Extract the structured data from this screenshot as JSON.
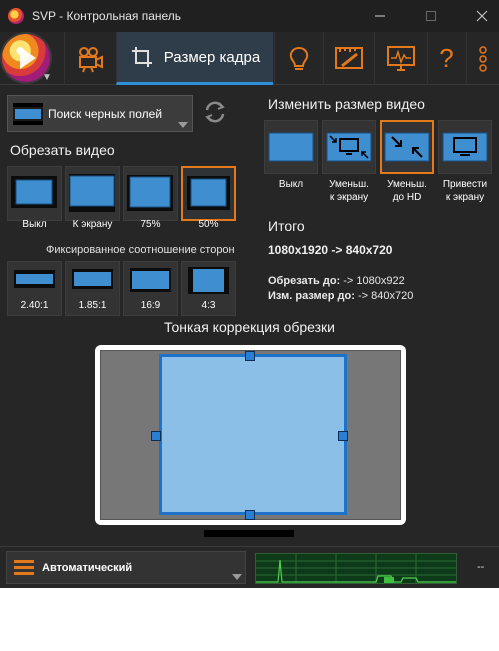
{
  "window": {
    "title": "SVP - Контрольная панель"
  },
  "titlebar": {
    "minimize_icon": "minimize-icon",
    "maximize_icon": "maximize-icon",
    "close_icon": "close-icon"
  },
  "toolbar": {
    "active_tab_label": "Размер кадра",
    "tabs": [
      "video-camera-icon",
      "crop-icon",
      "lightbulb-icon",
      "ruler-pencil-icon",
      "monitor-graph-icon",
      "help-icon",
      "more-vertical-icon"
    ],
    "help_label": "?"
  },
  "crop": {
    "detect_dropdown": "Поиск черных полей",
    "title": "Обрезать видео",
    "buttons": [
      {
        "label": "Выкл"
      },
      {
        "label": "К экрану"
      },
      {
        "label": "75%"
      },
      {
        "label": "50%",
        "selected": true
      }
    ],
    "fixed_ratio_title": "Фиксированное соотношение сторон",
    "ratios": [
      "2.40:1",
      "1.85:1",
      "16:9",
      "4:3"
    ]
  },
  "resize": {
    "title": "Изменить размер видео",
    "buttons": [
      {
        "label_line1": "Выкл",
        "label_line2": ""
      },
      {
        "label_line1": "Уменьш.",
        "label_line2": "к экрану"
      },
      {
        "label_line1": "Уменьш.",
        "label_line2": "до HD",
        "selected": true
      },
      {
        "label_line1": "Привести",
        "label_line2": "к экрану"
      }
    ]
  },
  "result": {
    "title": "Итого",
    "summary": "1080x1920 -> 840x720",
    "crop_to_label": "Обрезать до:",
    "crop_to_value": " -> 1080x922",
    "resize_to_label": "Изм. размер до:",
    "resize_to_value": " -> 840x720"
  },
  "fine_crop": {
    "title": "Тонкая коррекция обрезки"
  },
  "status": {
    "mode": "Автоматический",
    "fps": "--"
  },
  "colors": {
    "accent": "#e4791c",
    "selection_blue": "#2f8fd8",
    "background": "#262626"
  }
}
